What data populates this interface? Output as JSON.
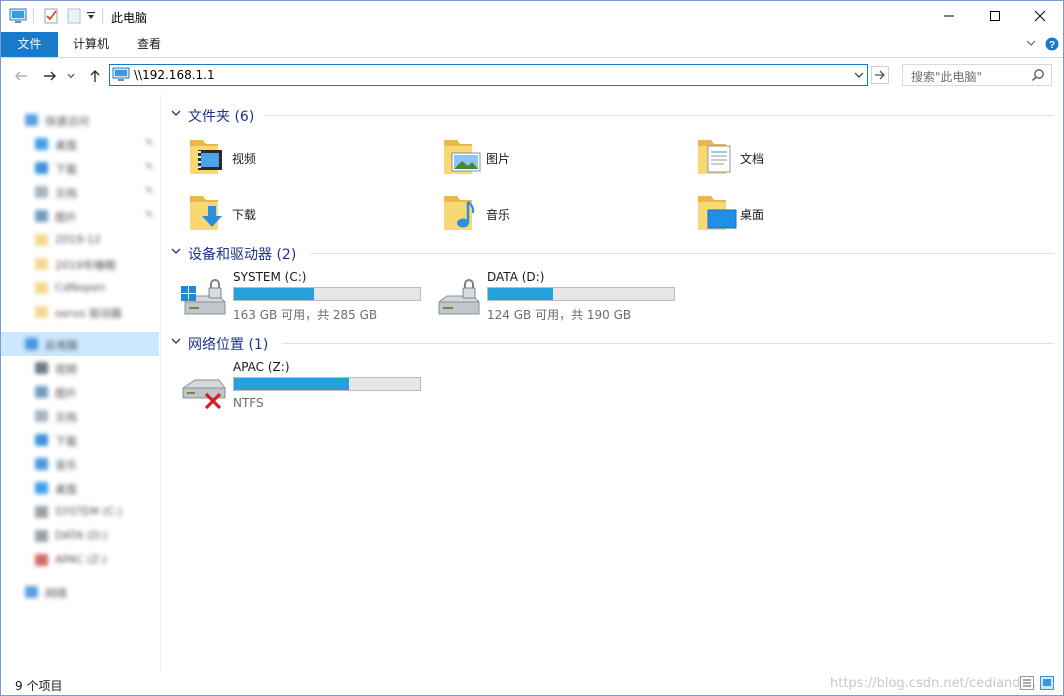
{
  "window": {
    "title": "此电脑"
  },
  "ribbon": {
    "tabs": [
      {
        "label": "文件",
        "active": true
      },
      {
        "label": "计算机",
        "active": false
      },
      {
        "label": "查看",
        "active": false
      }
    ]
  },
  "address": {
    "path": "\\\\192.168.1.1"
  },
  "search": {
    "placeholder": "搜索\"此电脑\""
  },
  "sidebar": {
    "items": [
      {
        "label": "快速访问",
        "icon": "star-icon",
        "color": "#3c8fde",
        "pinned": false,
        "top": true
      },
      {
        "label": "桌面",
        "icon": "desktop-icon",
        "color": "#1e90e6",
        "pinned": true
      },
      {
        "label": "下载",
        "icon": "download-icon",
        "color": "#1e7fd6",
        "pinned": true
      },
      {
        "label": "文档",
        "icon": "document-icon",
        "color": "#9aa7b4",
        "pinned": true
      },
      {
        "label": "图片",
        "icon": "pictures-icon",
        "color": "#5a8bb8",
        "pinned": true
      },
      {
        "label": "2019-12",
        "icon": "folder-icon",
        "color": "#f3d27a",
        "pinned": false
      },
      {
        "label": "2019年睡眠",
        "icon": "folder-icon",
        "color": "#f3d27a",
        "pinned": false
      },
      {
        "label": "CdNopen",
        "icon": "folder-icon",
        "color": "#f3d27a",
        "pinned": false
      },
      {
        "label": "servo 驱动器",
        "icon": "folder-icon",
        "color": "#f3d27a",
        "pinned": false
      },
      {
        "label": "此电脑",
        "icon": "computer-icon",
        "color": "#2b88d8",
        "pinned": false,
        "selected": true,
        "top": true
      },
      {
        "label": "视频",
        "icon": "video-icon",
        "color": "#556070",
        "pinned": false
      },
      {
        "label": "图片",
        "icon": "pictures-icon",
        "color": "#5a8bb8",
        "pinned": false
      },
      {
        "label": "文档",
        "icon": "document-icon",
        "color": "#9aa7b4",
        "pinned": false
      },
      {
        "label": "下载",
        "icon": "download-icon",
        "color": "#1e7fd6",
        "pinned": false
      },
      {
        "label": "音乐",
        "icon": "music-icon",
        "color": "#2b88d8",
        "pinned": false
      },
      {
        "label": "桌面",
        "icon": "desktop-icon",
        "color": "#1e90e6",
        "pinned": false
      },
      {
        "label": "SYSTEM (C:)",
        "icon": "drive-icon",
        "color": "#8a9099",
        "pinned": false
      },
      {
        "label": "DATA (D:)",
        "icon": "drive-icon",
        "color": "#8a9099",
        "pinned": false
      },
      {
        "label": "APAC (Z:)",
        "icon": "network-drive-icon",
        "color": "#c85050",
        "pinned": false
      },
      {
        "label": "网络",
        "icon": "network-icon",
        "color": "#3c8fde",
        "pinned": false,
        "top": true
      }
    ]
  },
  "groups": {
    "folders": {
      "title": "文件夹 (6)"
    },
    "drives": {
      "title": "设备和驱动器 (2)"
    },
    "network": {
      "title": "网络位置 (1)"
    }
  },
  "folders": [
    {
      "name": "视频",
      "overlay": "video"
    },
    {
      "name": "图片",
      "overlay": "pictures"
    },
    {
      "name": "文档",
      "overlay": "documents"
    },
    {
      "name": "下载",
      "overlay": "downloads"
    },
    {
      "name": "音乐",
      "overlay": "music"
    },
    {
      "name": "桌面",
      "overlay": "desktop"
    }
  ],
  "drives": [
    {
      "name": "SYSTEM (C:)",
      "detail": "163 GB 可用，共 285 GB",
      "used_fraction": 0.43,
      "os": true
    },
    {
      "name": "DATA (D:)",
      "detail": "124 GB 可用，共 190 GB",
      "used_fraction": 0.35,
      "os": false
    }
  ],
  "network_locations": [
    {
      "name": "APAC (Z:)",
      "detail": "NTFS",
      "used_fraction": 0.62,
      "disconnected": true
    }
  ],
  "status": {
    "item_count": "9 个项目",
    "watermark": "https://blog.csdn.net/cediandi..."
  },
  "colors": {
    "accent": "#1979ca",
    "bar_fill": "#26a0da",
    "group_title": "#1e3287",
    "selection": "#cce8ff"
  }
}
